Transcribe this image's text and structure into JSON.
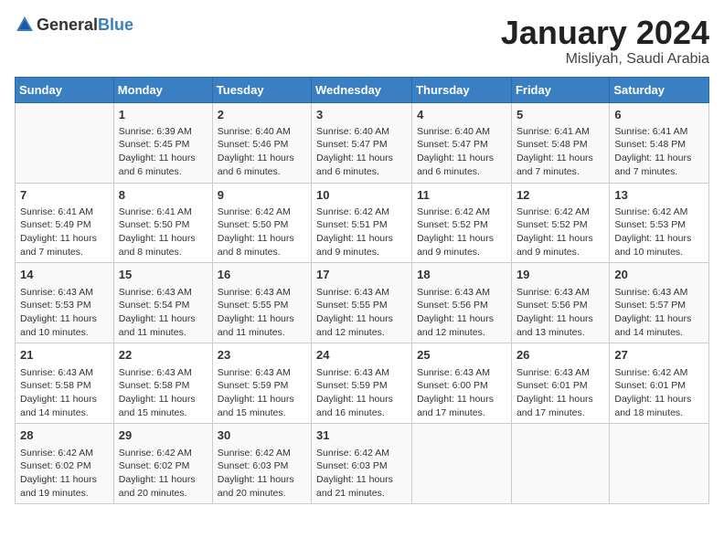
{
  "header": {
    "logo_general": "General",
    "logo_blue": "Blue",
    "title": "January 2024",
    "location": "Misliyah, Saudi Arabia"
  },
  "weekdays": [
    "Sunday",
    "Monday",
    "Tuesday",
    "Wednesday",
    "Thursday",
    "Friday",
    "Saturday"
  ],
  "weeks": [
    [
      {
        "day": "",
        "info": ""
      },
      {
        "day": "1",
        "info": "Sunrise: 6:39 AM\nSunset: 5:45 PM\nDaylight: 11 hours and 6 minutes."
      },
      {
        "day": "2",
        "info": "Sunrise: 6:40 AM\nSunset: 5:46 PM\nDaylight: 11 hours and 6 minutes."
      },
      {
        "day": "3",
        "info": "Sunrise: 6:40 AM\nSunset: 5:47 PM\nDaylight: 11 hours and 6 minutes."
      },
      {
        "day": "4",
        "info": "Sunrise: 6:40 AM\nSunset: 5:47 PM\nDaylight: 11 hours and 6 minutes."
      },
      {
        "day": "5",
        "info": "Sunrise: 6:41 AM\nSunset: 5:48 PM\nDaylight: 11 hours and 7 minutes."
      },
      {
        "day": "6",
        "info": "Sunrise: 6:41 AM\nSunset: 5:48 PM\nDaylight: 11 hours and 7 minutes."
      }
    ],
    [
      {
        "day": "7",
        "info": "Sunrise: 6:41 AM\nSunset: 5:49 PM\nDaylight: 11 hours and 7 minutes."
      },
      {
        "day": "8",
        "info": "Sunrise: 6:41 AM\nSunset: 5:50 PM\nDaylight: 11 hours and 8 minutes."
      },
      {
        "day": "9",
        "info": "Sunrise: 6:42 AM\nSunset: 5:50 PM\nDaylight: 11 hours and 8 minutes."
      },
      {
        "day": "10",
        "info": "Sunrise: 6:42 AM\nSunset: 5:51 PM\nDaylight: 11 hours and 9 minutes."
      },
      {
        "day": "11",
        "info": "Sunrise: 6:42 AM\nSunset: 5:52 PM\nDaylight: 11 hours and 9 minutes."
      },
      {
        "day": "12",
        "info": "Sunrise: 6:42 AM\nSunset: 5:52 PM\nDaylight: 11 hours and 9 minutes."
      },
      {
        "day": "13",
        "info": "Sunrise: 6:42 AM\nSunset: 5:53 PM\nDaylight: 11 hours and 10 minutes."
      }
    ],
    [
      {
        "day": "14",
        "info": "Sunrise: 6:43 AM\nSunset: 5:53 PM\nDaylight: 11 hours and 10 minutes."
      },
      {
        "day": "15",
        "info": "Sunrise: 6:43 AM\nSunset: 5:54 PM\nDaylight: 11 hours and 11 minutes."
      },
      {
        "day": "16",
        "info": "Sunrise: 6:43 AM\nSunset: 5:55 PM\nDaylight: 11 hours and 11 minutes."
      },
      {
        "day": "17",
        "info": "Sunrise: 6:43 AM\nSunset: 5:55 PM\nDaylight: 11 hours and 12 minutes."
      },
      {
        "day": "18",
        "info": "Sunrise: 6:43 AM\nSunset: 5:56 PM\nDaylight: 11 hours and 12 minutes."
      },
      {
        "day": "19",
        "info": "Sunrise: 6:43 AM\nSunset: 5:56 PM\nDaylight: 11 hours and 13 minutes."
      },
      {
        "day": "20",
        "info": "Sunrise: 6:43 AM\nSunset: 5:57 PM\nDaylight: 11 hours and 14 minutes."
      }
    ],
    [
      {
        "day": "21",
        "info": "Sunrise: 6:43 AM\nSunset: 5:58 PM\nDaylight: 11 hours and 14 minutes."
      },
      {
        "day": "22",
        "info": "Sunrise: 6:43 AM\nSunset: 5:58 PM\nDaylight: 11 hours and 15 minutes."
      },
      {
        "day": "23",
        "info": "Sunrise: 6:43 AM\nSunset: 5:59 PM\nDaylight: 11 hours and 15 minutes."
      },
      {
        "day": "24",
        "info": "Sunrise: 6:43 AM\nSunset: 5:59 PM\nDaylight: 11 hours and 16 minutes."
      },
      {
        "day": "25",
        "info": "Sunrise: 6:43 AM\nSunset: 6:00 PM\nDaylight: 11 hours and 17 minutes."
      },
      {
        "day": "26",
        "info": "Sunrise: 6:43 AM\nSunset: 6:01 PM\nDaylight: 11 hours and 17 minutes."
      },
      {
        "day": "27",
        "info": "Sunrise: 6:42 AM\nSunset: 6:01 PM\nDaylight: 11 hours and 18 minutes."
      }
    ],
    [
      {
        "day": "28",
        "info": "Sunrise: 6:42 AM\nSunset: 6:02 PM\nDaylight: 11 hours and 19 minutes."
      },
      {
        "day": "29",
        "info": "Sunrise: 6:42 AM\nSunset: 6:02 PM\nDaylight: 11 hours and 20 minutes."
      },
      {
        "day": "30",
        "info": "Sunrise: 6:42 AM\nSunset: 6:03 PM\nDaylight: 11 hours and 20 minutes."
      },
      {
        "day": "31",
        "info": "Sunrise: 6:42 AM\nSunset: 6:03 PM\nDaylight: 11 hours and 21 minutes."
      },
      {
        "day": "",
        "info": ""
      },
      {
        "day": "",
        "info": ""
      },
      {
        "day": "",
        "info": ""
      }
    ]
  ]
}
